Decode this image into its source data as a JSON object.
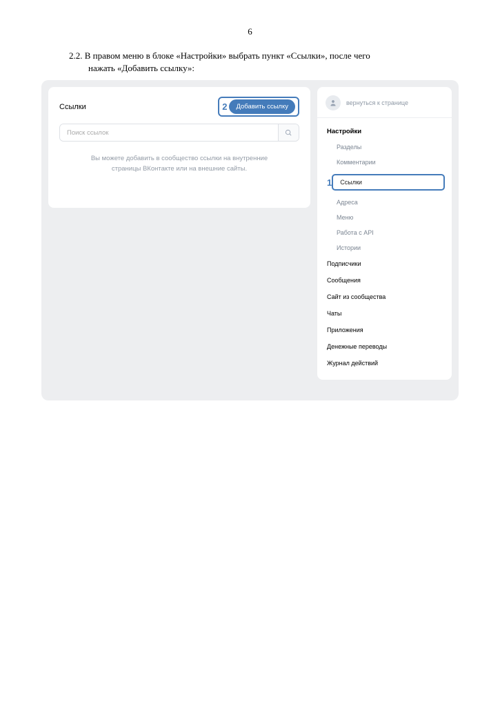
{
  "page_number": "6",
  "instruction": {
    "line1": "2.2. В правом меню в блоке «Настройки» выбрать пункт «Ссылки», после чего",
    "line2": "нажать «Добавить ссылку»:"
  },
  "main": {
    "title": "Ссылки",
    "callout_number": "2",
    "add_button": "Добавить ссылку",
    "search_placeholder": "Поиск ссылок",
    "help_text_line1": "Вы можете добавить в сообщество ссылки на внутренние",
    "help_text_line2": "страницы ВКонтакте или на внешние сайты."
  },
  "sidebar": {
    "back_label": "вернуться к странице",
    "settings_header": "Настройки",
    "sub_items": {
      "sections": "Разделы",
      "comments": "Комментарии",
      "links": "Ссылки",
      "addresses": "Адреса",
      "menu": "Меню",
      "api": "Работа с API",
      "stories": "Истории"
    },
    "callout_number_left": "1",
    "menu_items": {
      "subscribers": "Подписчики",
      "messages": "Сообщения",
      "site": "Сайт из сообщества",
      "chats": "Чаты",
      "apps": "Приложения",
      "transfers": "Денежные переводы",
      "journal": "Журнал действий"
    }
  }
}
